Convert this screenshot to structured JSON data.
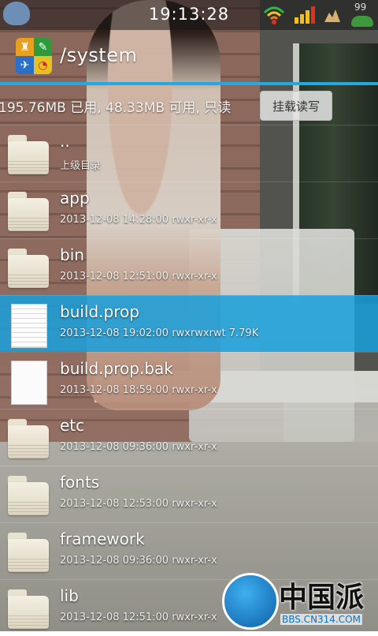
{
  "status_bar": {
    "time": "19:13:28",
    "battery_level": "99",
    "icons": [
      "user-icon",
      "wifi-icon",
      "signal-icon",
      "notification-icon",
      "battery-icon"
    ]
  },
  "path_header": {
    "path": "/system",
    "app_icon": "file-manager-icon"
  },
  "storage": {
    "info": "195.76MB 已用, 48.33MB 可用, 只读",
    "mount_button": "挂载读写"
  },
  "files": [
    {
      "name": "..",
      "meta": "上级目录",
      "icon": "folder-icon",
      "selected": false
    },
    {
      "name": "app",
      "meta": "2013-12-08 14:28:00  rwxr-xr-x",
      "icon": "folder-icon",
      "selected": false
    },
    {
      "name": "bin",
      "meta": "2013-12-08 12:51:00  rwxr-xr-x",
      "icon": "folder-icon",
      "selected": false
    },
    {
      "name": "build.prop",
      "meta": "2013-12-08 19:02:00  rwxrwxrwt  7.79K",
      "icon": "text-file-icon",
      "selected": true
    },
    {
      "name": "build.prop.bak",
      "meta": "2013-12-08 18:59:00  rwxr-xr-x",
      "icon": "file-icon",
      "selected": false
    },
    {
      "name": "etc",
      "meta": "2013-12-08 09:36:00  rwxr-xr-x",
      "icon": "folder-icon",
      "selected": false
    },
    {
      "name": "fonts",
      "meta": "2013-12-08 12:53:00  rwxr-xr-x",
      "icon": "folder-icon",
      "selected": false
    },
    {
      "name": "framework",
      "meta": "2013-12-08 09:36:00  rwxr-xr-x",
      "icon": "folder-icon",
      "selected": false
    },
    {
      "name": "lib",
      "meta": "2013-12-08 12:51:00  rwxr-xr-x",
      "icon": "folder-icon",
      "selected": false
    }
  ],
  "watermark": {
    "brand": "中国派",
    "url": "BBS.CN314.COM"
  },
  "colors": {
    "accent": "#23a8e0",
    "selected_row": "#18a0dc"
  }
}
